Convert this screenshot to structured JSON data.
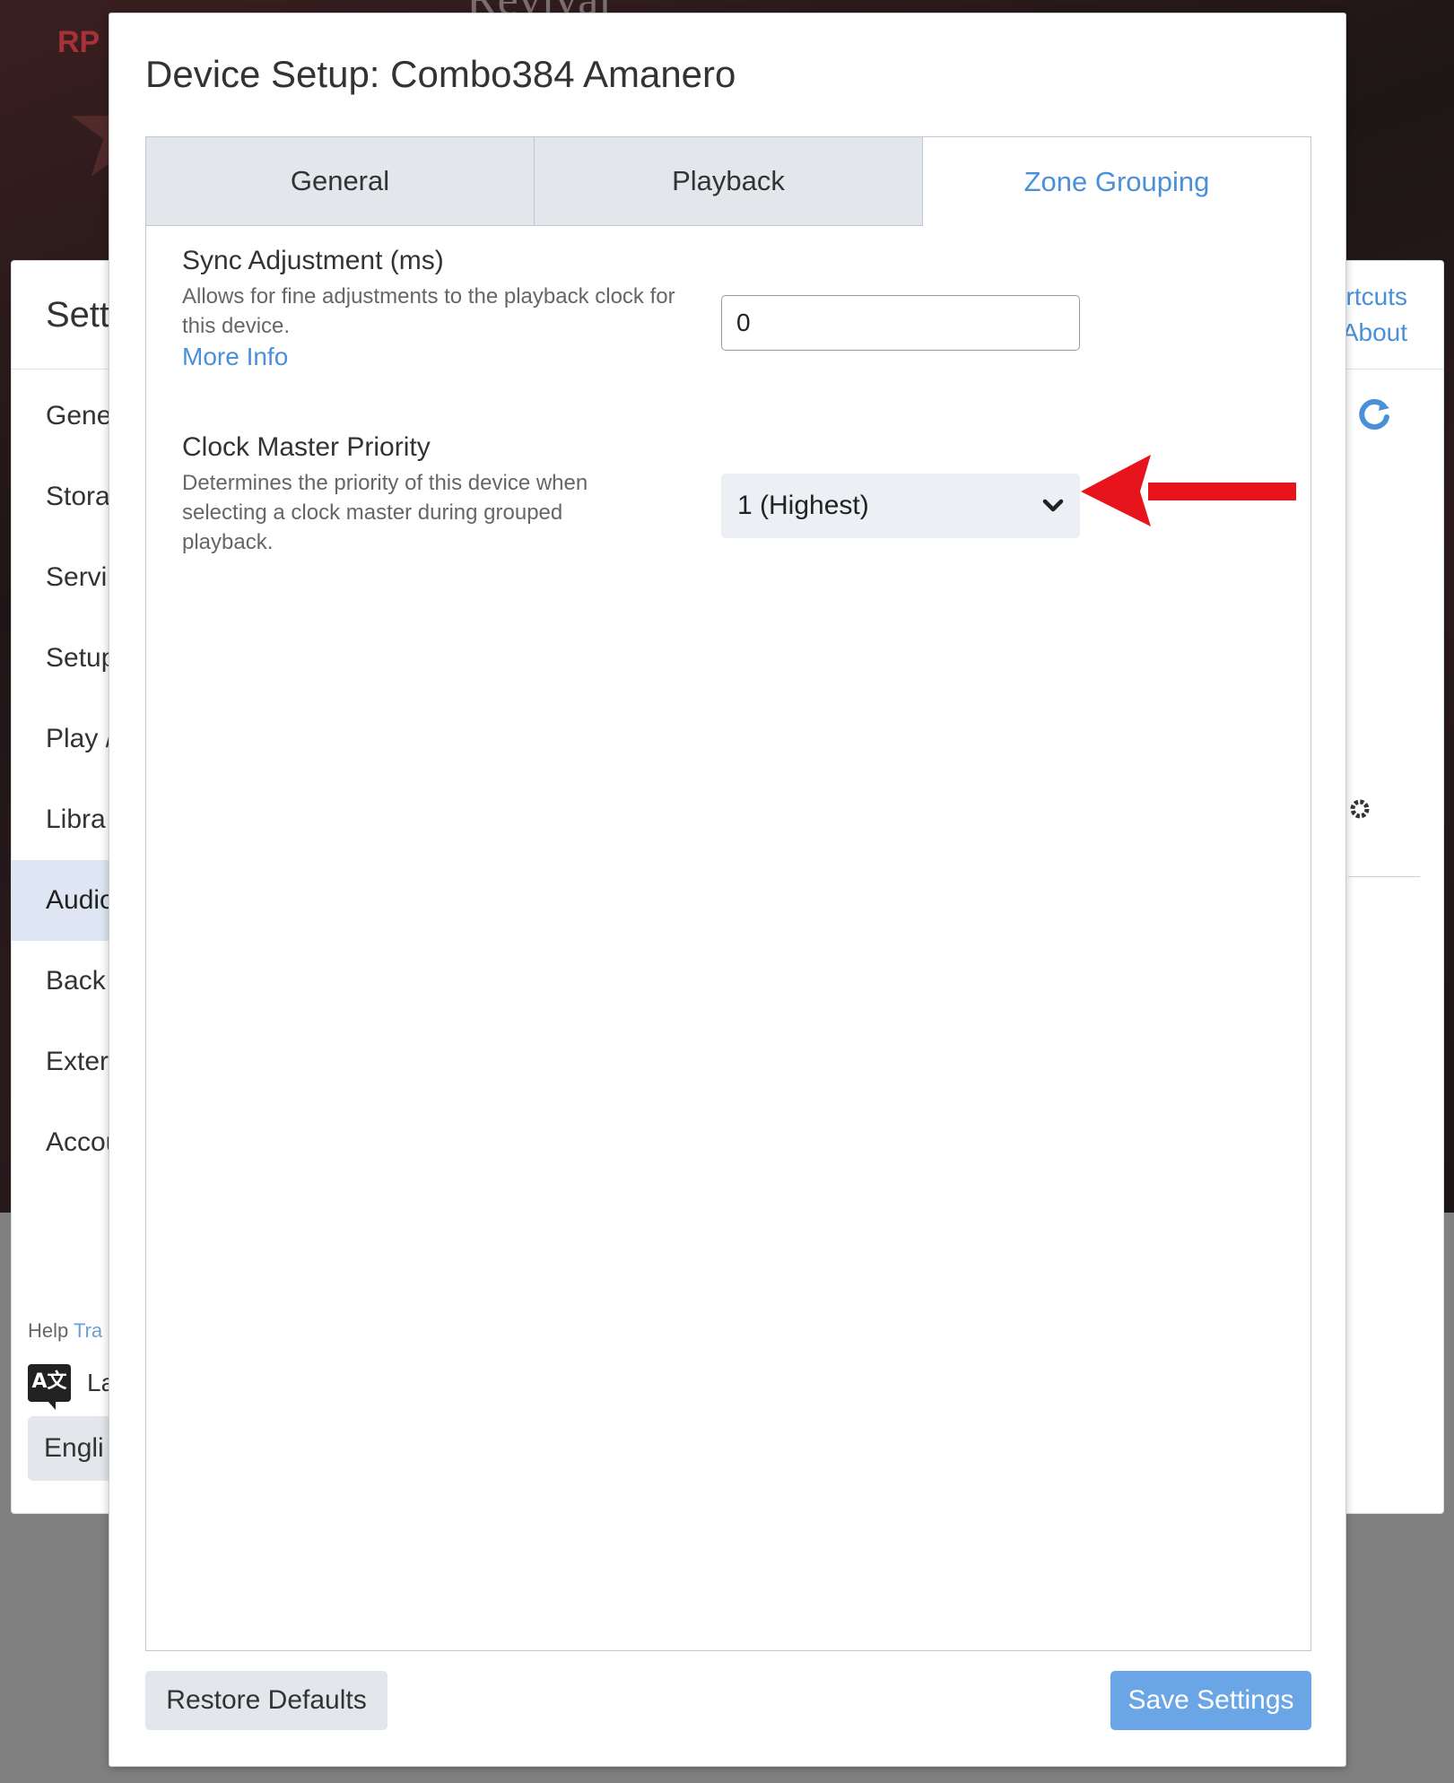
{
  "background": {
    "hero_title": "Revival",
    "hero_logo": "RP",
    "settings": {
      "title": "Sett",
      "nav_items": [
        {
          "label": "Gene",
          "active": false
        },
        {
          "label": "Stora",
          "active": false
        },
        {
          "label": "Servi",
          "active": false
        },
        {
          "label": "Setup",
          "active": false
        },
        {
          "label": "Play /",
          "active": false
        },
        {
          "label": "Libra",
          "active": false
        },
        {
          "label": "Audio",
          "active": true
        },
        {
          "label": "Back",
          "active": false
        },
        {
          "label": "Exter",
          "active": false
        },
        {
          "label": "Accou",
          "active": false
        }
      ],
      "help_prefix": "Help",
      "help_link": "Tra",
      "language_label": "La",
      "language_icon_text": "A文",
      "language_value": "Engli",
      "right_links": [
        "rtcuts",
        "About"
      ]
    }
  },
  "modal": {
    "title": "Device Setup: Combo384 Amanero",
    "tabs": [
      {
        "label": "General",
        "active": false
      },
      {
        "label": "Playback",
        "active": false
      },
      {
        "label": "Zone Grouping",
        "active": true
      }
    ],
    "sync": {
      "label": "Sync Adjustment (ms)",
      "description": "Allows for fine adjustments to the playback clock for this device.",
      "more_info": "More Info",
      "value": "0"
    },
    "clock": {
      "label": "Clock Master Priority",
      "description": "Determines the priority of this device when selecting a clock master during grouped playback.",
      "selected": "1 (Highest)"
    },
    "buttons": {
      "restore": "Restore Defaults",
      "save": "Save Settings"
    }
  },
  "colors": {
    "accent": "#4a90d9",
    "save_button": "#6aa6e6",
    "annotation_arrow": "#e8141b"
  },
  "icons": {
    "select_arrow": "chevron-down-icon",
    "refresh": "refresh-icon",
    "gear": "gear-icon",
    "annotation": "red-arrow-icon"
  }
}
